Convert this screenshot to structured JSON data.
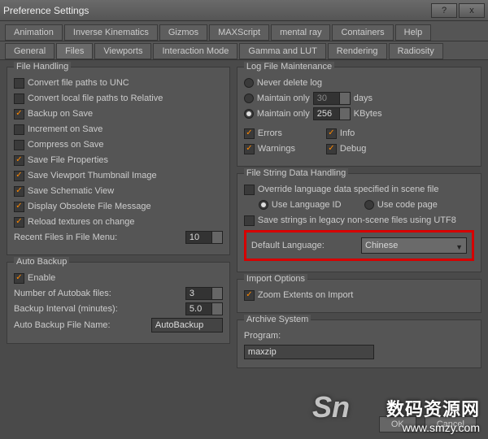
{
  "title": "Preference Settings",
  "tabs_row1": [
    "Animation",
    "Inverse Kinematics",
    "Gizmos",
    "MAXScript",
    "mental ray",
    "Containers",
    "Help"
  ],
  "tabs_row2": [
    "General",
    "Files",
    "Viewports",
    "Interaction Mode",
    "Gamma and LUT",
    "Rendering",
    "Radiosity"
  ],
  "active_tab": "Files",
  "file_handling": {
    "legend": "File Handling",
    "convert_unc": {
      "checked": false,
      "label": "Convert file paths to UNC"
    },
    "convert_rel": {
      "checked": false,
      "label": "Convert local file paths to Relative"
    },
    "backup_save": {
      "checked": true,
      "label": "Backup on Save"
    },
    "incr_save": {
      "checked": false,
      "label": "Increment on Save"
    },
    "compress_save": {
      "checked": false,
      "label": "Compress on Save"
    },
    "save_props": {
      "checked": true,
      "label": "Save File Properties"
    },
    "save_thumb": {
      "checked": true,
      "label": "Save Viewport Thumbnail Image"
    },
    "save_schem": {
      "checked": true,
      "label": "Save Schematic View"
    },
    "disp_obs": {
      "checked": true,
      "label": "Display Obsolete File Message"
    },
    "reload_tex": {
      "checked": true,
      "label": "Reload textures on change"
    },
    "recent_label": "Recent Files in File Menu:",
    "recent_value": "10"
  },
  "auto_backup": {
    "legend": "Auto Backup",
    "enable": {
      "checked": true,
      "label": "Enable"
    },
    "num_label": "Number of Autobak files:",
    "num_value": "3",
    "interval_label": "Backup Interval (minutes):",
    "interval_value": "5.0",
    "filename_label": "Auto Backup File Name:",
    "filename_value": "AutoBackup"
  },
  "log": {
    "legend": "Log File Maintenance",
    "never": {
      "label": "Never delete log"
    },
    "maintain_days": {
      "label": "Maintain only",
      "value": "30",
      "unit": "days"
    },
    "maintain_kb": {
      "label": "Maintain only",
      "value": "256",
      "unit": "KBytes"
    },
    "selected": "maintain_kb",
    "errors": {
      "checked": true,
      "label": "Errors"
    },
    "info": {
      "checked": true,
      "label": "Info"
    },
    "warnings": {
      "checked": true,
      "label": "Warnings"
    },
    "debug": {
      "checked": true,
      "label": "Debug"
    }
  },
  "strings": {
    "legend": "File String Data Handling",
    "override": {
      "checked": false,
      "label": "Override language data specified in scene file"
    },
    "use_lang": {
      "label": "Use Language ID"
    },
    "use_cp": {
      "label": "Use code page"
    },
    "sub_selected": "use_lang",
    "utf8": {
      "checked": false,
      "label": "Save strings in legacy non-scene files using UTF8"
    },
    "def_lang_label": "Default Language:",
    "def_lang_value": "Chinese"
  },
  "import": {
    "legend": "Import Options",
    "zoom": {
      "checked": true,
      "label": "Zoom Extents on Import"
    }
  },
  "archive": {
    "legend": "Archive System",
    "program_label": "Program:",
    "program_value": "maxzip"
  },
  "buttons": {
    "ok": "OK",
    "cancel": "Cancel"
  },
  "watermark": {
    "big": "数码资源网",
    "small": "www.smzy.com",
    "logo": "Sn"
  }
}
